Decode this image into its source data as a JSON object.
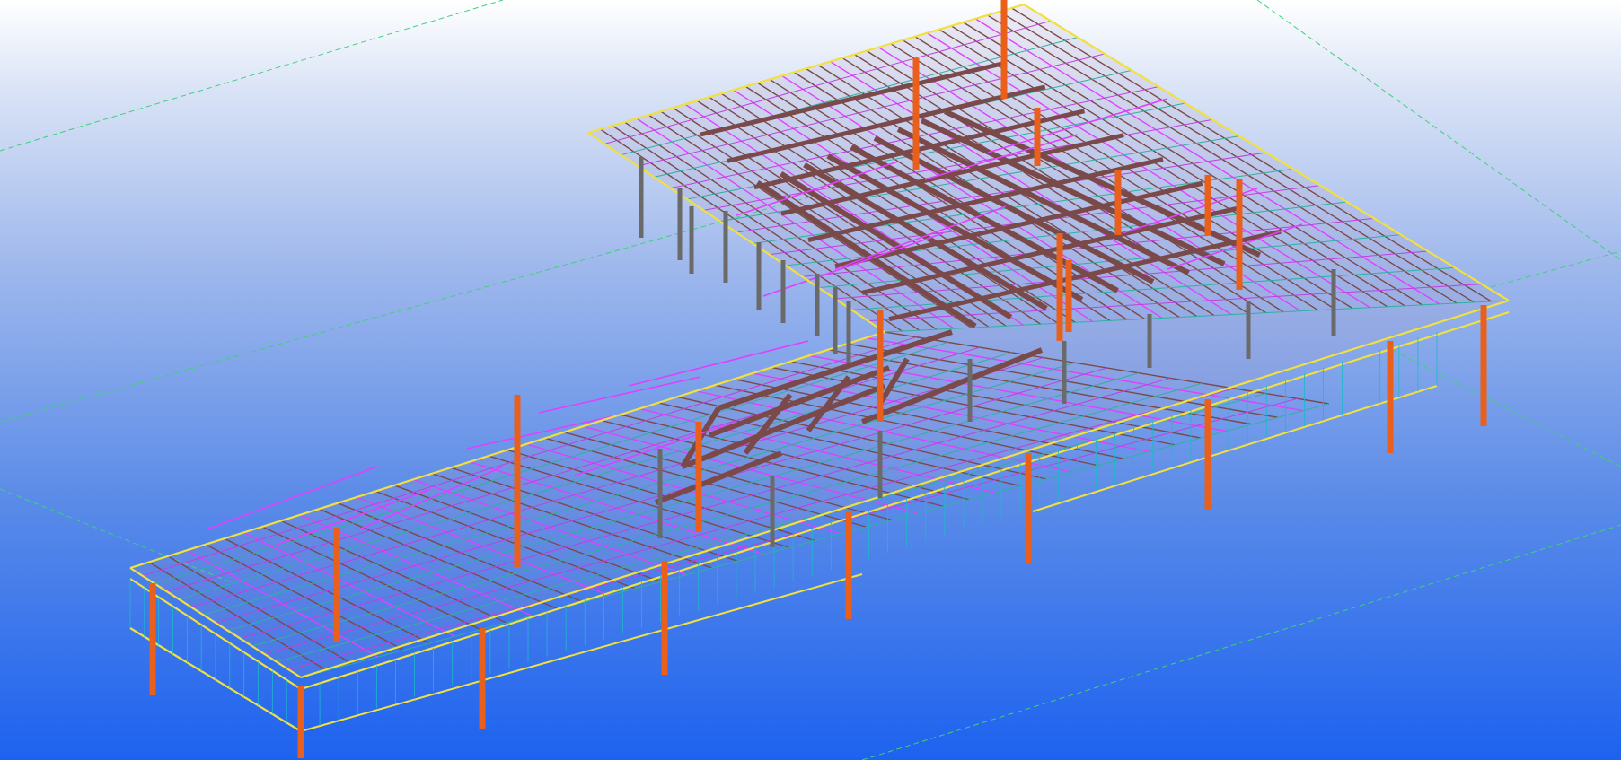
{
  "viewport": {
    "view": "3D",
    "background": {
      "top": "#ffffff",
      "bottom": "#1d62ef"
    }
  },
  "colors": {
    "grid": "#3fd07a",
    "column": "#e8601c",
    "column_grey": "#6a6a6a",
    "primary_beam": "#7a4a4a",
    "edge_beam": "#f0e040",
    "purlin": "#7a4a4a",
    "bracing": "#e040ff",
    "bracing_alt": "#c040e0",
    "cladding_line": "#1fb8c8",
    "secondary": "#30b0a0"
  }
}
